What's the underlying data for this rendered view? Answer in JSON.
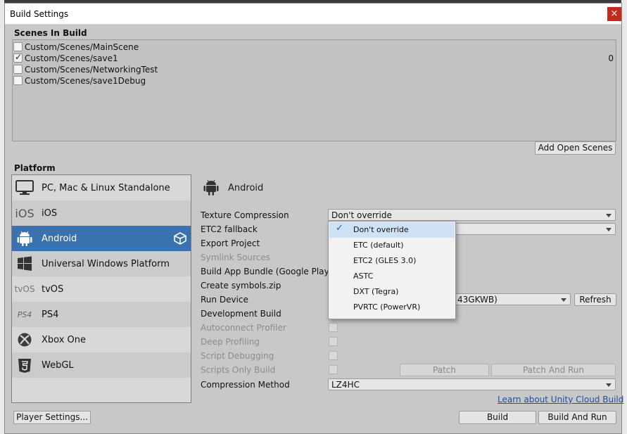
{
  "window": {
    "title": "Build Settings",
    "close_glyph": "×"
  },
  "scenes": {
    "header": "Scenes In Build",
    "items": [
      {
        "name": "Custom/Scenes/MainScene",
        "checked": false,
        "index": ""
      },
      {
        "name": "Custom/Scenes/save1",
        "checked": true,
        "index": "0"
      },
      {
        "name": "Custom/Scenes/NetworkingTest",
        "checked": false,
        "index": ""
      },
      {
        "name": "Custom/Scenes/save1Debug",
        "checked": false,
        "index": ""
      }
    ],
    "add_open_scenes_label": "Add Open Scenes"
  },
  "platform": {
    "header": "Platform",
    "items": [
      {
        "label": "PC, Mac & Linux Standalone",
        "icon": "monitor-icon"
      },
      {
        "label": "iOS",
        "icon": "ios-icon",
        "icon_text": "iOS"
      },
      {
        "label": "Android",
        "icon": "android-icon",
        "selected": true
      },
      {
        "label": "Universal Windows Platform",
        "icon": "windows-icon"
      },
      {
        "label": "tvOS",
        "icon": "tvos-icon",
        "icon_text": "tvOS"
      },
      {
        "label": "PS4",
        "icon": "ps4-icon",
        "icon_text": "PS4"
      },
      {
        "label": "Xbox One",
        "icon": "xbox-icon"
      },
      {
        "label": "WebGL",
        "icon": "html5-icon"
      }
    ],
    "player_settings_label": "Player Settings..."
  },
  "android": {
    "title": "Android",
    "texture_compression_label": "Texture Compression",
    "texture_compression_value": "Don't override",
    "etc2_fallback_label": "ETC2 fallback",
    "export_project_label": "Export Project",
    "symlink_sources_label": "Symlink Sources",
    "build_app_bundle_label": "Build App Bundle (Google Play)",
    "create_symbols_label": "Create symbols.zip",
    "run_device_label": "Run Device",
    "run_device_value": "43GKWB)",
    "refresh_label": "Refresh",
    "development_build_label": "Development Build",
    "autoconnect_profiler_label": "Autoconnect Profiler",
    "deep_profiling_label": "Deep Profiling",
    "script_debugging_label": "Script Debugging",
    "scripts_only_build_label": "Scripts Only Build",
    "patch_label": "Patch",
    "patch_and_run_label": "Patch And Run",
    "compression_method_label": "Compression Method",
    "compression_method_value": "LZ4HC"
  },
  "texture_popup": {
    "options": [
      {
        "label": "Don't override",
        "checked": true
      },
      {
        "label": "ETC (default)",
        "checked": false
      },
      {
        "label": "ETC2 (GLES 3.0)",
        "checked": false
      },
      {
        "label": "ASTC",
        "checked": false
      },
      {
        "label": "DXT (Tegra)",
        "checked": false
      },
      {
        "label": "PVRTC (PowerVR)",
        "checked": false
      }
    ],
    "check_glyph": "✓"
  },
  "footer": {
    "cloud_build_link": "Learn about Unity Cloud Build",
    "build_label": "Build",
    "build_and_run_label": "Build And Run"
  },
  "colors": {
    "selected_platform": "#3a72b0",
    "link": "#1d4fa6",
    "close_button": "#c42b1c"
  }
}
